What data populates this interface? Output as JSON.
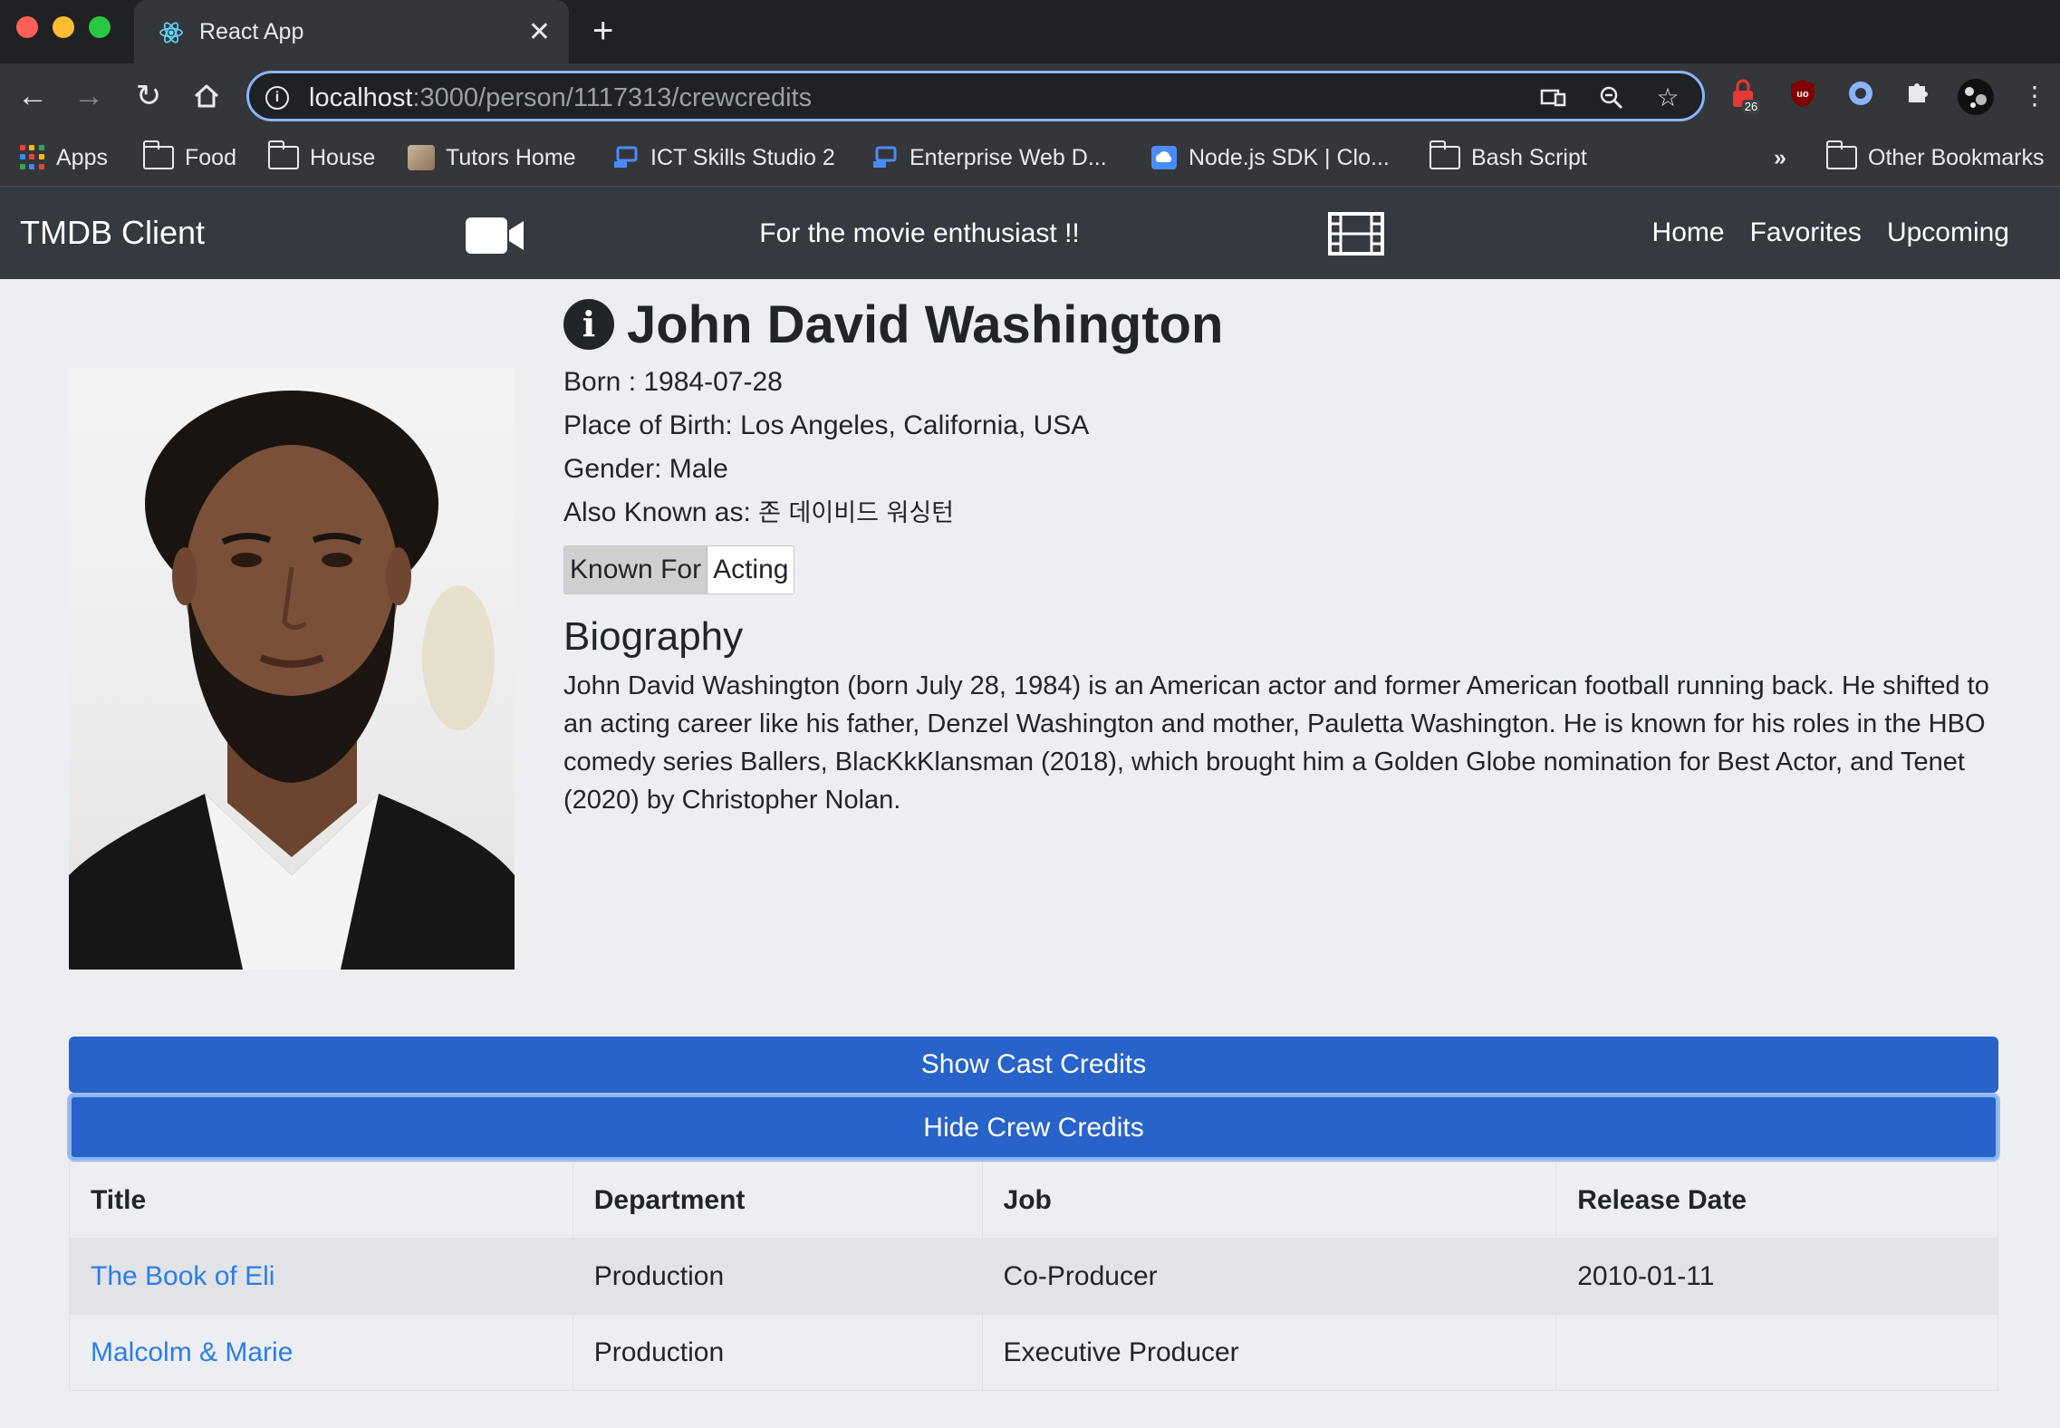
{
  "browser": {
    "tab_title": "React App",
    "url_host": "localhost",
    "url_path": ":3000/person/1117313/crewcredits",
    "extension_badge": "26",
    "bookmarks": [
      {
        "label": "Apps",
        "icon": "apps-grid-icon"
      },
      {
        "label": "Food",
        "icon": "folder-icon"
      },
      {
        "label": "House",
        "icon": "folder-icon"
      },
      {
        "label": "Tutors Home",
        "icon": "site-favicon"
      },
      {
        "label": "ICT Skills Studio 2",
        "icon": "site-favicon"
      },
      {
        "label": "Enterprise Web D...",
        "icon": "site-favicon"
      },
      {
        "label": "Node.js SDK | Clo...",
        "icon": "cloud-favicon"
      },
      {
        "label": "Bash Script",
        "icon": "folder-icon"
      }
    ],
    "overflow": "»",
    "other_bookmarks": "Other Bookmarks"
  },
  "navbar": {
    "brand": "TMDB Client",
    "tagline": "For the movie enthusiast !!",
    "links": [
      "Home",
      "Favorites",
      "Upcoming"
    ]
  },
  "person": {
    "name": "John David Washington",
    "born": "Born : 1984-07-28",
    "birthplace": "Place of Birth: Los Angeles, California, USA",
    "gender": "Gender: Male",
    "aka_label": "Also Known as:",
    "aka_value": "존 데이비드 워싱턴",
    "known_for_label": "Known For",
    "known_for_value": "Acting",
    "biography_heading": "Biography",
    "biography": "John David Washington (born July 28, 1984) is an American actor and former American football running back. He shifted to an acting career like his father, Denzel Washington and mother, Pauletta Washington. He is known for his roles in the HBO comedy series Ballers, BlacKkKlansman (2018), which brought him a Golden Globe nomination for Best Actor, and Tenet (2020) by Christopher Nolan."
  },
  "actions": {
    "show_cast": "Show Cast Credits",
    "hide_crew": "Hide Crew Credits"
  },
  "crew_table": {
    "headers": [
      "Title",
      "Department",
      "Job",
      "Release Date"
    ],
    "rows": [
      {
        "title": "The Book of Eli",
        "department": "Production",
        "job": "Co-Producer",
        "release_date": "2010-01-11"
      },
      {
        "title": "Malcolm & Marie",
        "department": "Production",
        "job": "Executive Producer",
        "release_date": ""
      }
    ]
  },
  "colors": {
    "navbar_bg": "#343a40",
    "primary_button": "#2763c8",
    "link": "#2b7de9",
    "page_bg": "#eceef2"
  }
}
